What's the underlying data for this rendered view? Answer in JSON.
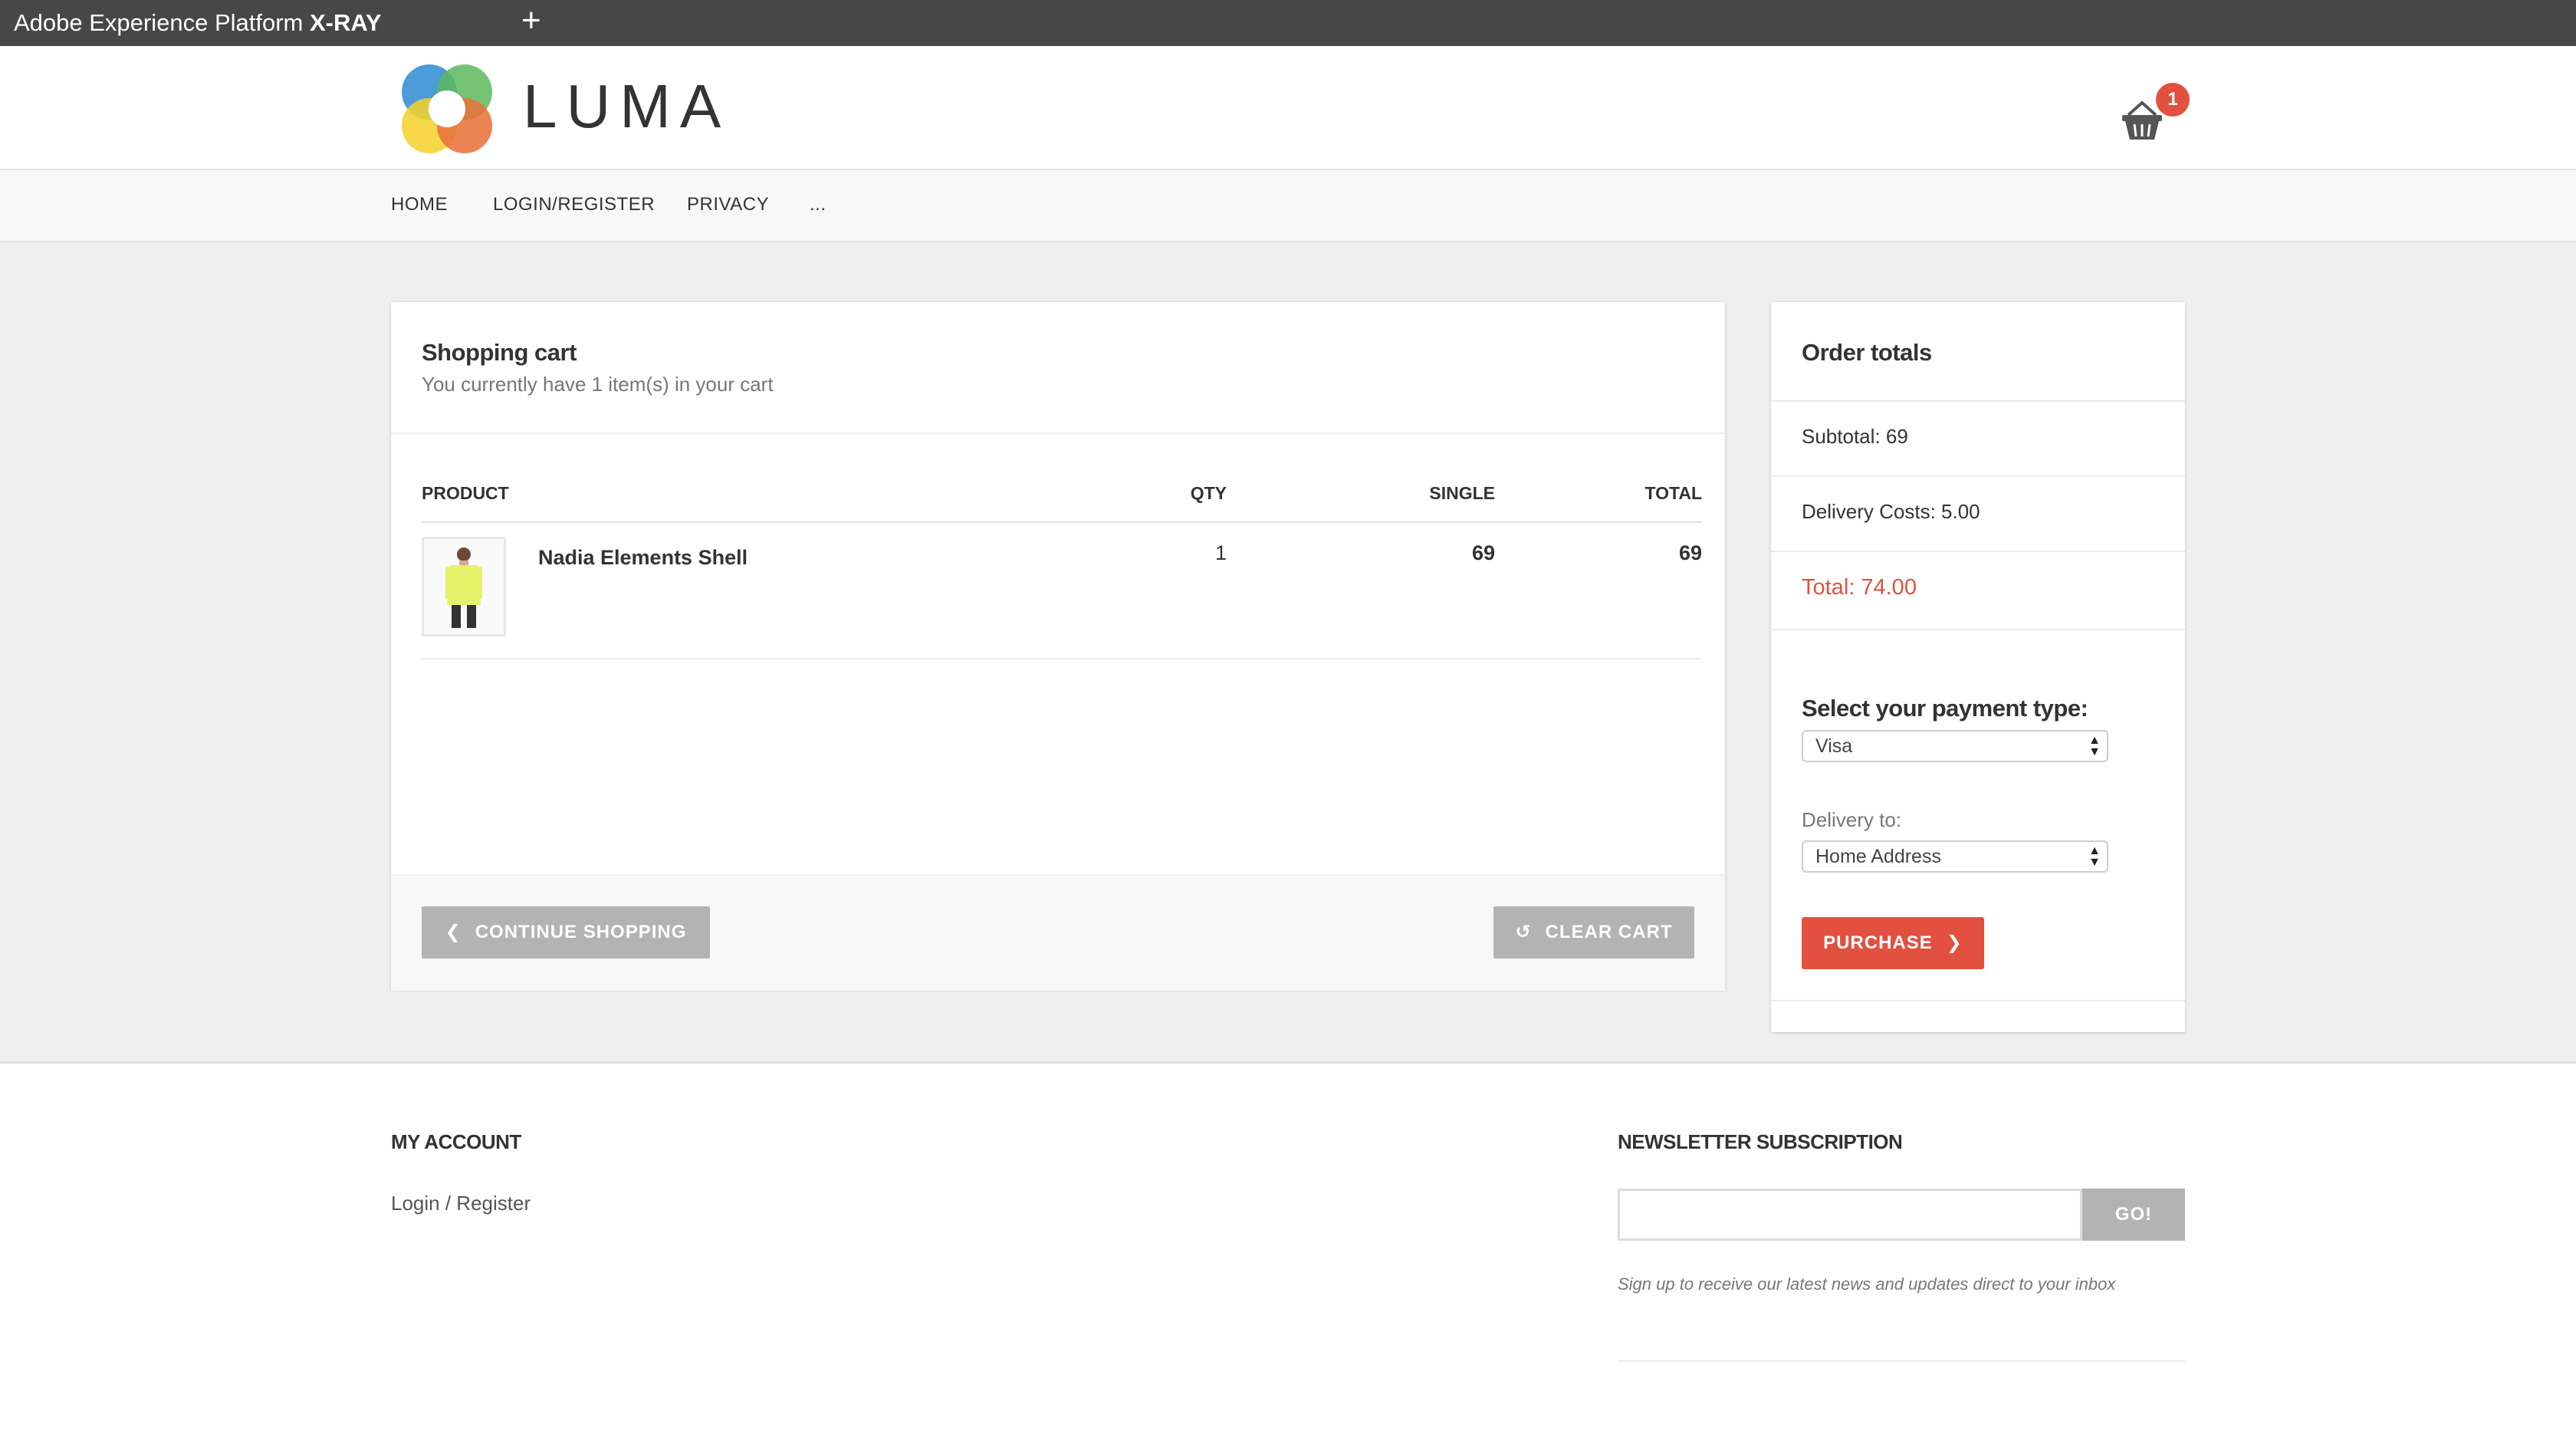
{
  "topbar": {
    "title_prefix": "Adobe Experience Platform ",
    "title_strong": "X-RAY",
    "new_tab_label": "+"
  },
  "brand": {
    "name": "LUMA",
    "cart_count": "1"
  },
  "nav": {
    "items": [
      "HOME",
      "LOGIN/REGISTER",
      "PRIVACY",
      "..."
    ]
  },
  "cart": {
    "title": "Shopping cart",
    "subtitle": "You currently have 1 item(s) in your cart",
    "headers": {
      "product": "PRODUCT",
      "qty": "QTY",
      "single": "SINGLE",
      "total": "TOTAL"
    },
    "items": [
      {
        "name": "Nadia Elements Shell",
        "qty": "1",
        "single": "69",
        "total": "69"
      }
    ],
    "continue_label": "CONTINUE SHOPPING",
    "clear_label": "CLEAR CART"
  },
  "totals": {
    "title": "Order totals",
    "subtotal": "Subtotal: 69",
    "delivery": "Delivery Costs: 5.00",
    "total": "Total: 74.00",
    "payment_label": "Select your payment type:",
    "payment_value": "Visa",
    "delivery_label": "Delivery to:",
    "delivery_value": "Home Address",
    "purchase_label": "PURCHASE"
  },
  "footer": {
    "account_title": "MY ACCOUNT",
    "account_link": "Login / Register",
    "newsletter_title": "NEWSLETTER SUBSCRIPTION",
    "newsletter_placeholder": "",
    "go_label": "GO!",
    "newsletter_note": "Sign up to receive our latest news and updates direct to your inbox"
  },
  "colors": {
    "accent": "#e2503f",
    "topbar": "#474747",
    "button_grey": "#b3b3b3"
  }
}
